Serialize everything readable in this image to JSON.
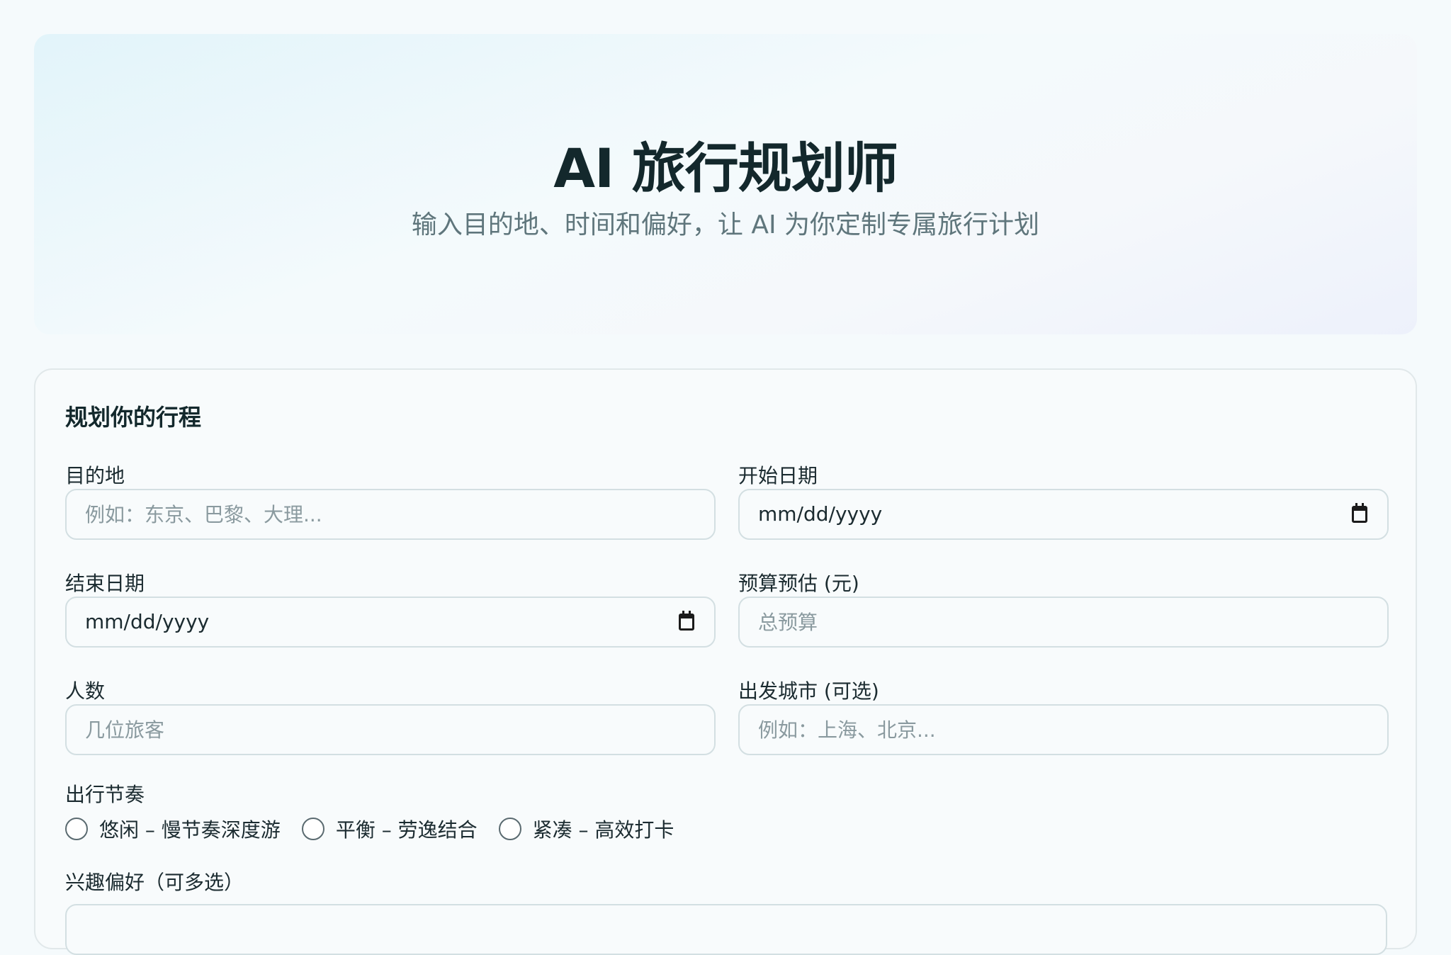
{
  "hero": {
    "title": "AI 旅行规划师",
    "subtitle": "输入目的地、时间和偏好，让 AI 为你定制专属旅行计划"
  },
  "form": {
    "title": "规划你的行程",
    "destination": {
      "label": "目的地",
      "placeholder": "例如：东京、巴黎、大理..."
    },
    "start_date": {
      "label": "开始日期",
      "value": "mm/dd/yyyy",
      "icon": "calendar-icon"
    },
    "end_date": {
      "label": "结束日期",
      "value": "mm/dd/yyyy",
      "icon": "calendar-icon"
    },
    "budget": {
      "label": "预算预估 (元)",
      "placeholder": "总预算"
    },
    "people": {
      "label": "人数",
      "placeholder": "几位旅客"
    },
    "departure": {
      "label": "出发城市 (可选)",
      "placeholder": "例如：上海、北京..."
    },
    "pace": {
      "label": "出行节奏",
      "options": [
        {
          "label": "悠闲 – 慢节奏深度游",
          "selected": false
        },
        {
          "label": "平衡 – 劳逸结合",
          "selected": false
        },
        {
          "label": "紧凑 – 高效打卡",
          "selected": false
        }
      ]
    },
    "interests": {
      "label": "兴趣偏好（可多选）"
    }
  }
}
